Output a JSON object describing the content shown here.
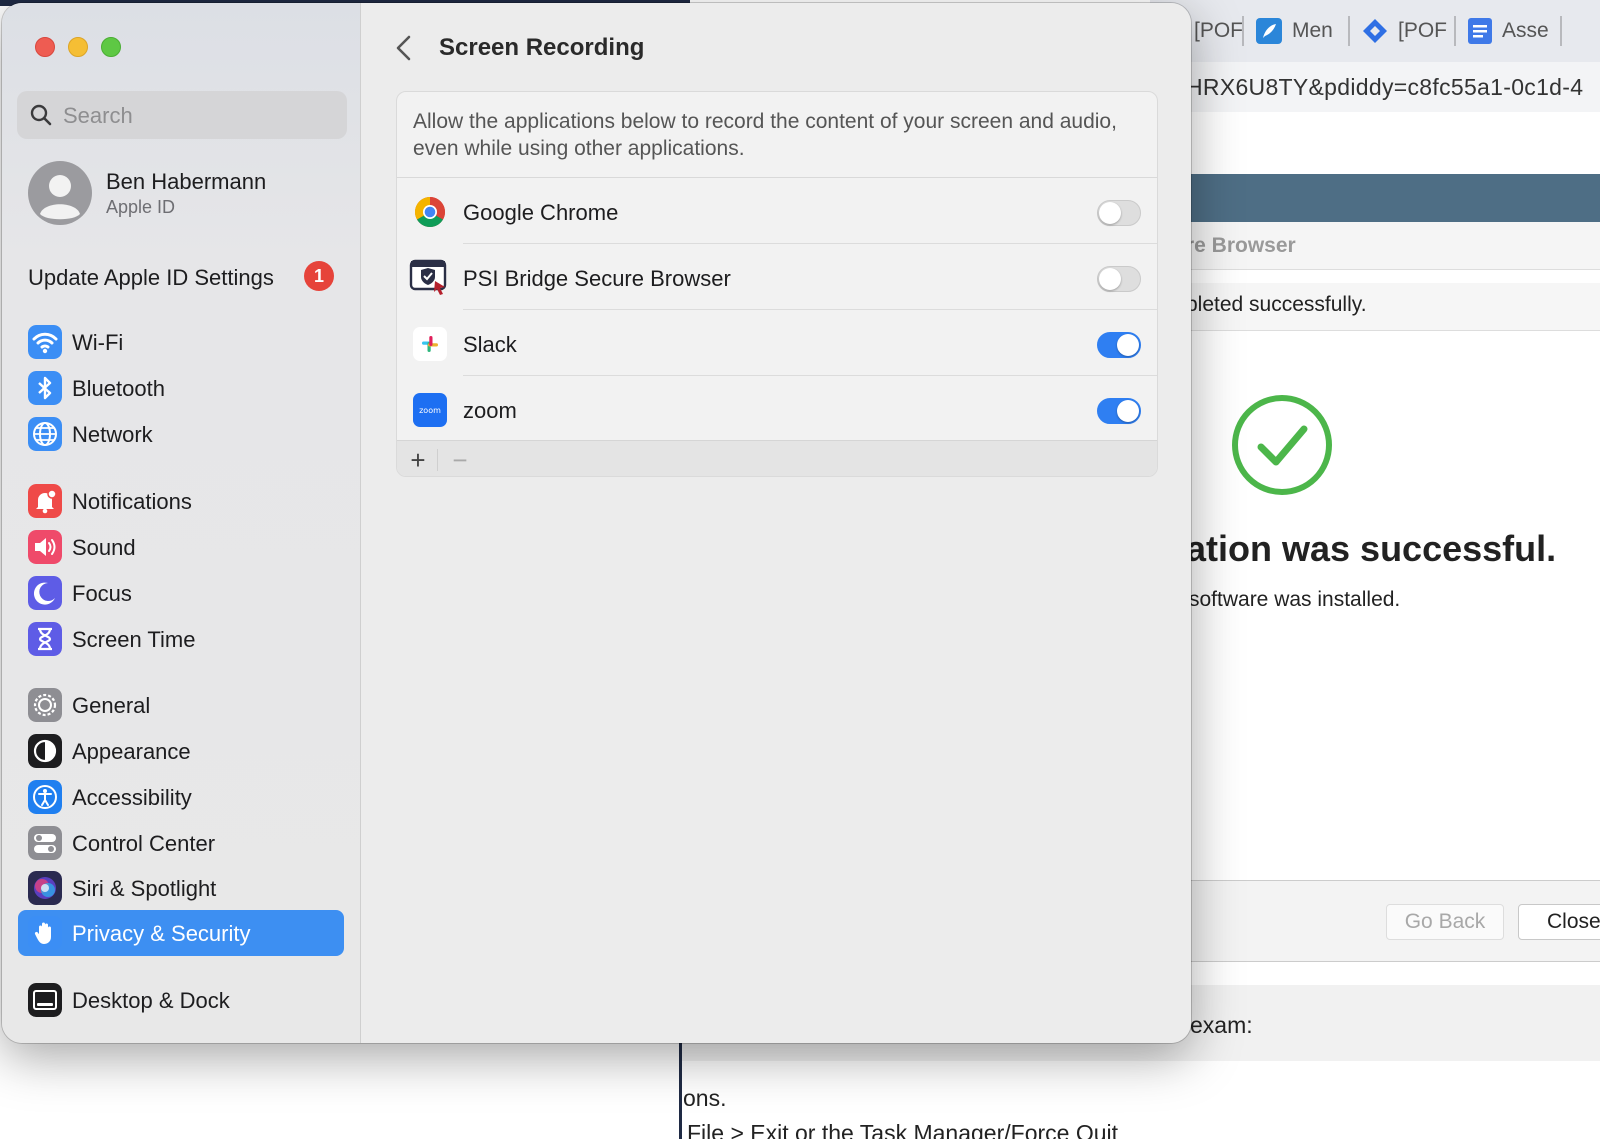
{
  "browser": {
    "tabs": [
      {
        "label": "[POF",
        "icon": "jira-icon"
      },
      {
        "label": "Men",
        "icon": "feather-icon"
      },
      {
        "label": "[POF",
        "icon": "jira-icon"
      },
      {
        "label": "Asse",
        "icon": "docs-icon"
      }
    ],
    "url": "HRX6U8TY&pdiddy=c8fc55a1-0c1d-4",
    "dialog_title": "re Browser",
    "dialog_message": "pleted successfully.",
    "success_heading": "ation was successful.",
    "success_sub": "software was installed.",
    "go_back": "Go Back",
    "close": "Close",
    "exam_text": "exam:",
    "ons_text": "ons.",
    "file_text": "File > Exit or the Task Manager/Force Quit",
    "success_color": "#4cb64a"
  },
  "sidebar": {
    "search_placeholder": "Search",
    "user_name": "Ben Habermann",
    "user_sub": "Apple ID",
    "update_label": "Update Apple ID Settings",
    "update_badge": "1",
    "items": [
      {
        "label": "Wi-Fi",
        "icon": "wifi-icon",
        "color": "#3b8ef5"
      },
      {
        "label": "Bluetooth",
        "icon": "bluetooth-icon",
        "color": "#3b8ef5"
      },
      {
        "label": "Network",
        "icon": "globe-icon",
        "color": "#3b8ef5"
      },
      {
        "label": "Notifications",
        "icon": "bell-icon",
        "color": "#ef4a48"
      },
      {
        "label": "Sound",
        "icon": "speaker-icon",
        "color": "#ef4a6a"
      },
      {
        "label": "Focus",
        "icon": "moon-icon",
        "color": "#5e5ce6"
      },
      {
        "label": "Screen Time",
        "icon": "hourglass-icon",
        "color": "#5e5ce6"
      },
      {
        "label": "General",
        "icon": "gear-icon",
        "color": "#8e8e93"
      },
      {
        "label": "Appearance",
        "icon": "appearance-icon",
        "color": "#1d1d1f"
      },
      {
        "label": "Accessibility",
        "icon": "accessibility-icon",
        "color": "#1f7ff0"
      },
      {
        "label": "Control Center",
        "icon": "switches-icon",
        "color": "#8e8e93"
      },
      {
        "label": "Siri & Spotlight",
        "icon": "siri-icon",
        "color": "#2a2a50"
      },
      {
        "label": "Privacy & Security",
        "icon": "hand-icon",
        "color": "#3b8ef5"
      },
      {
        "label": "Desktop & Dock",
        "icon": "dock-icon",
        "color": "#1d1d1f"
      }
    ],
    "selected_index": 12
  },
  "content": {
    "title": "Screen Recording",
    "description": "Allow the applications below to record the content of your screen and audio, even while using other applications.",
    "apps": [
      {
        "name": "Google Chrome",
        "icon": "chrome-icon",
        "enabled": false
      },
      {
        "name": "PSI Bridge Secure Browser",
        "icon": "psi-bridge-icon",
        "enabled": false
      },
      {
        "name": "Slack",
        "icon": "slack-icon",
        "enabled": true
      },
      {
        "name": "zoom",
        "icon": "zoom-icon",
        "enabled": true
      }
    ],
    "add_label": "+",
    "remove_label": "−",
    "accent_color": "#2f7ff2"
  }
}
